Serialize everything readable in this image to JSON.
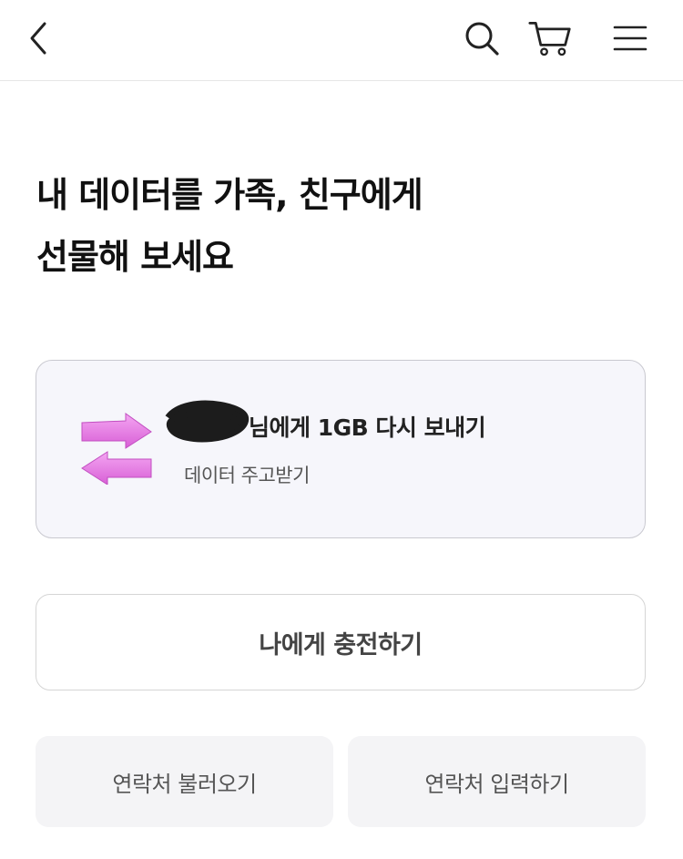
{
  "header": {
    "icons": [
      "back-icon",
      "search-icon",
      "cart-icon",
      "menu-icon"
    ]
  },
  "main": {
    "title_line1": "내 데이터를 가족, 친구에게",
    "title_line2": "선물해 보세요",
    "gift_card": {
      "main_text": "님에게 1GB 다시 보내기",
      "sub_text": "데이터 주고받기",
      "icon": "exchange-arrows-icon",
      "accent_color": "#e77ee6"
    },
    "charge_button": "나에게 충전하기",
    "contact_load_button": "연락처 불러오기",
    "contact_input_button": "연락처 입력하기"
  }
}
